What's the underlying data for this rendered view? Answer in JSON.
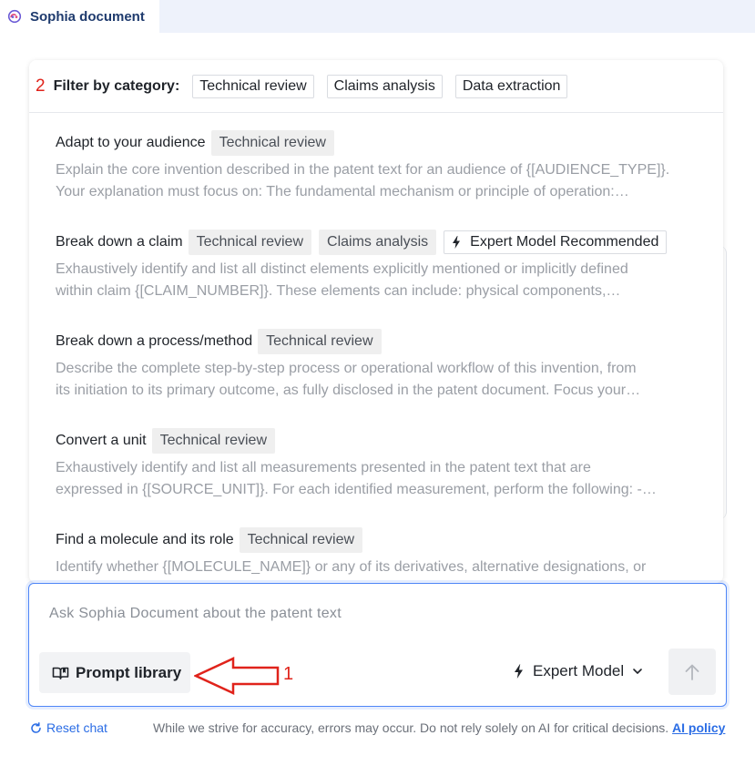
{
  "app": {
    "title": "Sophia document",
    "logo_icon": "sophia-logo-icon"
  },
  "annotations": {
    "filter_step": "2",
    "prompt_library_step": "1",
    "color": "#e0231b"
  },
  "filter": {
    "label": "Filter by category:",
    "categories": [
      "Technical review",
      "Claims analysis",
      "Data extraction"
    ]
  },
  "prompts": [
    {
      "title": "Adapt to your audience",
      "tags": [
        "Technical review"
      ],
      "desc_line1": "Explain the core invention described in the patent text for an audience of {[AUDIENCE_TYPE]}.",
      "desc_line2": "Your explanation must focus on: The fundamental mechanism or principle of operation:…"
    },
    {
      "title": "Break down a claim",
      "tags": [
        "Technical review",
        "Claims analysis"
      ],
      "badge": "Expert Model Recommended",
      "badge_icon": "lightning-icon",
      "desc_line1": "Exhaustively identify and list all distinct elements explicitly mentioned or implicitly defined",
      "desc_line2": "within claim {[CLAIM_NUMBER]}. These elements can include: physical components,…"
    },
    {
      "title": "Break down a process/method",
      "tags": [
        "Technical review"
      ],
      "desc_line1": "Describe the complete step-by-step process or operational workflow of this invention, from",
      "desc_line2": "its initiation to its primary outcome, as fully disclosed in the patent document. Focus your…"
    },
    {
      "title": "Convert a unit",
      "tags": [
        "Technical review"
      ],
      "desc_line1": "Exhaustively identify and list all measurements presented in the patent text that are",
      "desc_line2": "expressed in {[SOURCE_UNIT]}. For each identified measurement, perform the following: -…"
    },
    {
      "title": "Find a molecule and its role",
      "tags": [
        "Technical review"
      ],
      "desc_line1": "Identify whether {[MOLECULE_NAME]} or any of its derivatives, alternative designations, or",
      "desc_line2": ""
    }
  ],
  "composer": {
    "placeholder": "Ask Sophia Document about the patent text",
    "value": "",
    "prompt_library_label": "Prompt library",
    "model_label": "Expert Model",
    "accent": "#4f86f7"
  },
  "footer": {
    "reset_label": "Reset chat",
    "disclaimer": "While we strive for accuracy, errors may occur. Do not rely solely on AI for critical decisions.",
    "policy_label": "AI policy",
    "link_color": "#2b6de5"
  }
}
